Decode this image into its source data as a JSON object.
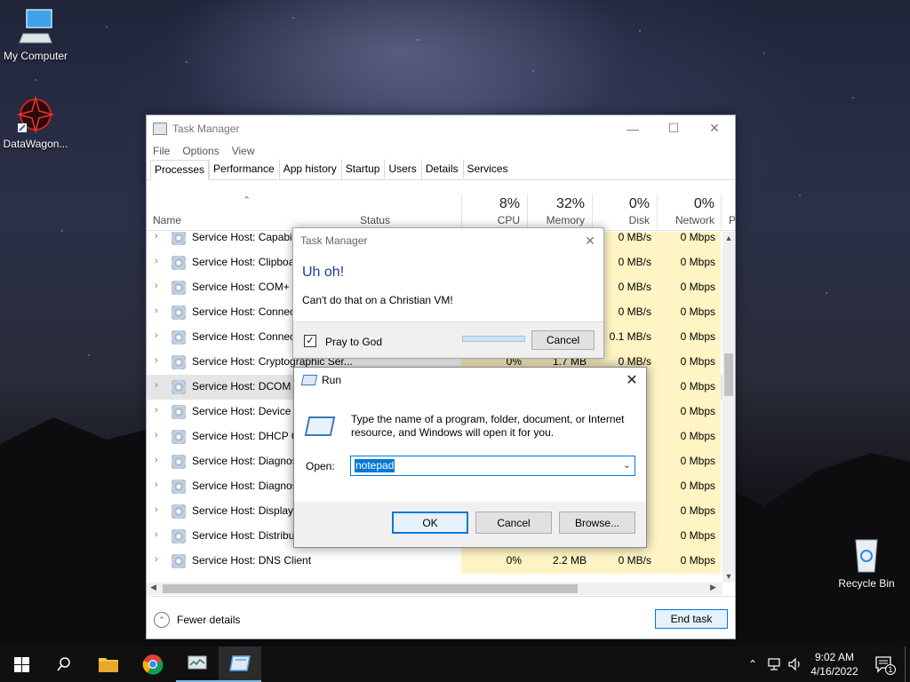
{
  "desktop": {
    "icons": [
      {
        "label": "My Computer"
      },
      {
        "label": "DataWagon..."
      },
      {
        "label": "Recycle Bin"
      }
    ]
  },
  "task_manager": {
    "title": "Task Manager",
    "menu": [
      "File",
      "Options",
      "View"
    ],
    "tabs": [
      "Processes",
      "Performance",
      "App history",
      "Startup",
      "Users",
      "Details",
      "Services"
    ],
    "active_tab": "Processes",
    "columns": {
      "name": "Name",
      "status": "Status",
      "cpu_pct": "8%",
      "cpu": "CPU",
      "mem_pct": "32%",
      "mem": "Memory",
      "disk_pct": "0%",
      "disk": "Disk",
      "net_pct": "0%",
      "net": "Network",
      "power": "P"
    },
    "rows": [
      {
        "name": "Service Host: Capabili",
        "cpu": "",
        "mem": "",
        "disk": "0 MB/s",
        "net": "0 Mbps"
      },
      {
        "name": "Service Host: Clipboa",
        "cpu": "",
        "mem": "",
        "disk": "0 MB/s",
        "net": "0 Mbps"
      },
      {
        "name": "Service Host: COM+ E",
        "cpu": "",
        "mem": "",
        "disk": "0 MB/s",
        "net": "0 Mbps"
      },
      {
        "name": "Service Host: Connect",
        "cpu": "",
        "mem": "",
        "disk": "0 MB/s",
        "net": "0 Mbps"
      },
      {
        "name": "Service Host: Connect",
        "cpu": "",
        "mem": "",
        "disk": "0.1 MB/s",
        "net": "0 Mbps"
      },
      {
        "name": "Service Host: Cryptographic Ser...",
        "cpu": "0%",
        "mem": "1.7 MB",
        "disk": "0 MB/s",
        "net": "0 Mbps"
      },
      {
        "name": "Service Host: DCOM S",
        "cpu": "",
        "mem": "",
        "disk": "",
        "net": "0 Mbps"
      },
      {
        "name": "Service Host: Device S",
        "cpu": "",
        "mem": "",
        "disk": "",
        "net": "0 Mbps"
      },
      {
        "name": "Service Host: DHCP Cl",
        "cpu": "",
        "mem": "",
        "disk": "",
        "net": "0 Mbps"
      },
      {
        "name": "Service Host: Diagnost",
        "cpu": "",
        "mem": "",
        "disk": "",
        "net": "0 Mbps"
      },
      {
        "name": "Service Host: Diagnost",
        "cpu": "",
        "mem": "",
        "disk": "",
        "net": "0 Mbps"
      },
      {
        "name": "Service Host: Display P",
        "cpu": "",
        "mem": "",
        "disk": "",
        "net": "0 Mbps"
      },
      {
        "name": "Service Host: Distribut",
        "cpu": "",
        "mem": "",
        "disk": "",
        "net": "0 Mbps"
      },
      {
        "name": "Service Host: DNS Client",
        "cpu": "0%",
        "mem": "2.2 MB",
        "disk": "0 MB/s",
        "net": "0 Mbps"
      }
    ],
    "fewer_details": "Fewer details",
    "end_task": "End task"
  },
  "alert_dialog": {
    "title": "Task Manager",
    "heading": "Uh oh!",
    "message": "Can't do that on a Christian VM!",
    "checkbox_label": "Pray to God",
    "checkbox_checked": true,
    "progress_fraction": 1.0,
    "cancel": "Cancel"
  },
  "run_dialog": {
    "title": "Run",
    "description": "Type the name of a program, folder, document, or Internet resource, and Windows will open it for you.",
    "open_label": "Open:",
    "open_value": "notepad",
    "ok": "OK",
    "cancel": "Cancel",
    "browse": "Browse..."
  },
  "taskbar": {
    "time": "9:02 AM",
    "date": "4/16/2022",
    "notification_count": "1",
    "accent": "#76b9ed"
  }
}
